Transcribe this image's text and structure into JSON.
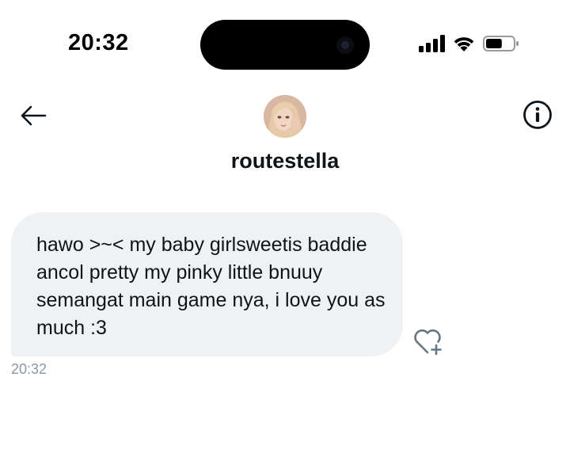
{
  "status_bar": {
    "time": "20:32",
    "battery_level": 0.6,
    "signal_bars": 4
  },
  "header": {
    "username": "routestella"
  },
  "icons": {
    "back": "arrow-left-icon",
    "info": "info-circle-icon",
    "react": "heart-plus-icon",
    "signal": "cellular-signal-icon",
    "wifi": "wifi-icon",
    "battery": "battery-icon"
  },
  "colors": {
    "bubble_background": "#eff1f3",
    "text": "#0f1419",
    "timestamp": "#8b98a5",
    "react_icon": "#657786"
  },
  "message": {
    "text": "hawo >~< my baby girlsweetis baddie ancol pretty my pinky little bnuuy semangat main game nya, i love you as much :3",
    "timestamp": "20:32"
  }
}
